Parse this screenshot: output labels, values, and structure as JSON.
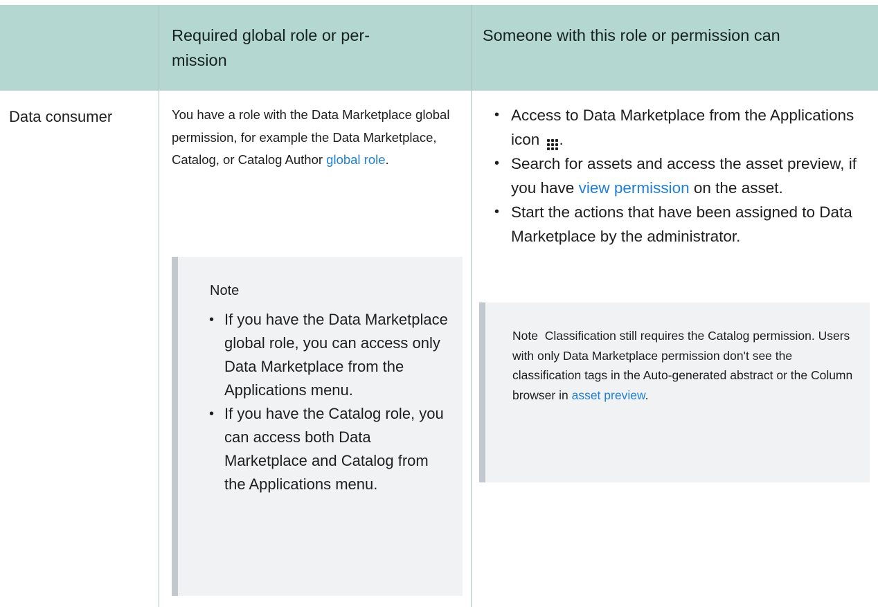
{
  "table": {
    "header": {
      "col1": "",
      "col2": "Required global role or per-\nmission",
      "col3": "Someone with this role or permission can"
    },
    "row": {
      "role": "Data consumer",
      "requirement": {
        "text_before": "You have a role with the Data Marketplace global permission, for example the Data Marketplace, Catalog, or Catalog Author ",
        "link": "global role",
        "text_after": ".",
        "note": {
          "title": "Note",
          "items": [
            "If you have the Data Marketplace global role, you can access only Data Marketplace from the Applications menu.",
            "If you have the Catalog role, you can access both Data Marketplace and Catalog from the Applications menu."
          ]
        }
      },
      "abilities": {
        "items": [
          {
            "before": "Access to Data Marketplace from the Applications icon",
            "icon": "applications-grid-icon",
            "after": "."
          },
          {
            "before": "Search for assets and access the asset preview, if you have ",
            "link": "view permission",
            "after": " on the asset."
          },
          {
            "before": "Start the actions that have been assigned to Data Marketplace by the administrator."
          }
        ],
        "note": {
          "label": "Note",
          "text": "Classification still requires the Catalog permission. Users with only Data Marketplace permission don't see the classification tags in the Auto-generated abstract or the Column browser in ",
          "link": "asset preview",
          "after": "."
        }
      }
    }
  },
  "colors": {
    "header_bg": "#b5d7d1",
    "link": "#1f7fd6",
    "note_bg": "#f0f2f3",
    "note_border": "#c2c9ce"
  }
}
